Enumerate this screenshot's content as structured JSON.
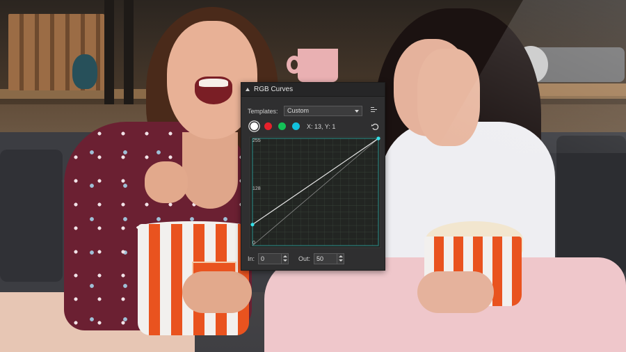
{
  "panel": {
    "title": "RGB Curves",
    "templates_label": "Templates:",
    "template_value": "Custom",
    "coordinate_readout": "X: 13, Y: 1",
    "channels": [
      {
        "name": "rgb",
        "color": "#ffffff",
        "selected": true
      },
      {
        "name": "red",
        "color": "#e6212b",
        "selected": false
      },
      {
        "name": "green",
        "color": "#14c157",
        "selected": false
      },
      {
        "name": "blue",
        "color": "#12c1de",
        "selected": false
      }
    ],
    "graph": {
      "label_top": "255",
      "label_mid": "128",
      "label_bottom": "0",
      "curve_points": [
        {
          "in": 0,
          "out": 50
        },
        {
          "in": 255,
          "out": 255
        }
      ]
    },
    "in_label": "In:",
    "in_value": "0",
    "out_label": "Out:",
    "out_value": "50"
  },
  "icons": {
    "collapse": "triangle-up-icon",
    "template_menu": "list-options-icon",
    "reset": "reset-icon"
  }
}
